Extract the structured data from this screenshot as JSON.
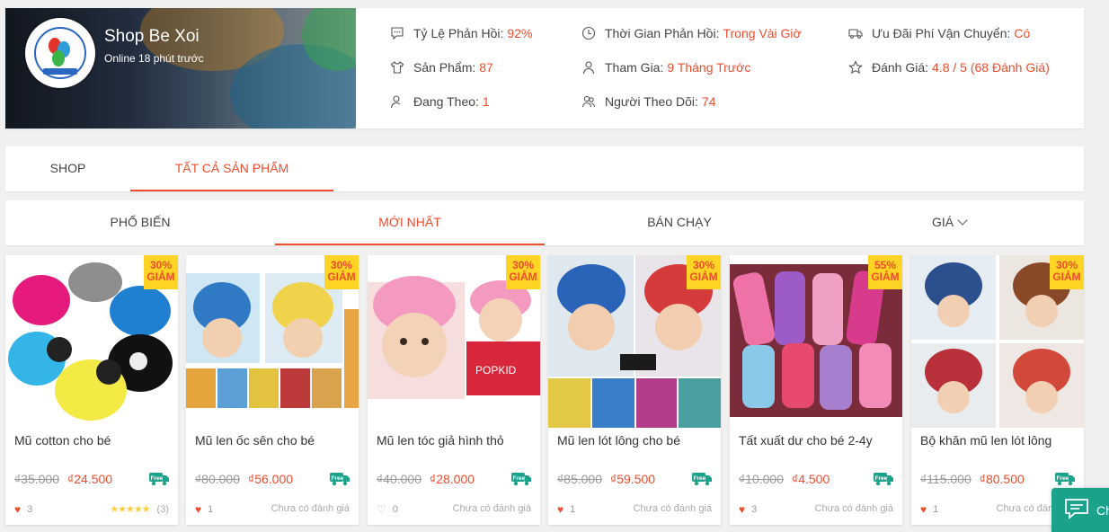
{
  "shop": {
    "name": "Shop Be Xoi",
    "online": "Online 18 phút trước"
  },
  "stats": [
    {
      "icon": "chat-bubble-icon",
      "label": "Tỷ Lệ Phản Hồi:",
      "value": "92%"
    },
    {
      "icon": "clock-icon",
      "label": "Thời Gian Phản Hồi:",
      "value": "Trong Vài Giờ"
    },
    {
      "icon": "truck-icon",
      "label": "Ưu Đãi Phí Vận Chuyển:",
      "value": "Có"
    },
    {
      "icon": "shirt-icon",
      "label": "Sản Phẩm:",
      "value": "87"
    },
    {
      "icon": "user-icon",
      "label": "Tham Gia:",
      "value": "9 Tháng Trước"
    },
    {
      "icon": "star-icon",
      "label": "Đánh Giá:",
      "value": "4.8 / 5 (68 Đánh Giá)"
    },
    {
      "icon": "user-follow-icon",
      "label": "Đang Theo:",
      "value": "1"
    },
    {
      "icon": "users-icon",
      "label": "Người Theo Dõi:",
      "value": "74"
    }
  ],
  "tabs": [
    {
      "label": "SHOP"
    },
    {
      "label": "TẤT CẢ SẢN PHẨM"
    }
  ],
  "sort": [
    {
      "label": "PHỔ BIẾN"
    },
    {
      "label": "MỚI NHẤT"
    },
    {
      "label": "BÁN CHẠY"
    },
    {
      "label": "GIÁ"
    }
  ],
  "discount_word": "GIẢM",
  "products": [
    {
      "title": "Mũ cotton cho bé",
      "old_price": "₫35.000",
      "price": "₫24.500",
      "discount": "30%",
      "likes": "3",
      "liked": true,
      "rating_text": "(3)",
      "rating": 4.5
    },
    {
      "title": "Mũ len ốc sên cho bé",
      "old_price": "₫80.000",
      "price": "₫56.000",
      "discount": "30%",
      "likes": "1",
      "liked": true,
      "rating_text": "Chưa có đánh giá"
    },
    {
      "title": "Mũ len tóc giả hình thỏ",
      "old_price": "₫40.000",
      "price": "₫28.000",
      "discount": "30%",
      "likes": "0",
      "liked": false,
      "rating_text": "Chưa có đánh giá"
    },
    {
      "title": "Mũ len lót lông cho bé",
      "old_price": "₫85.000",
      "price": "₫59.500",
      "discount": "30%",
      "likes": "1",
      "liked": true,
      "rating_text": "Chưa có đánh giá"
    },
    {
      "title": "Tất xuất dư cho bé 2-4y",
      "old_price": "₫10.000",
      "price": "₫4.500",
      "discount": "55%",
      "likes": "3",
      "liked": true,
      "rating_text": "Chưa có đánh giá"
    },
    {
      "title": "Bộ khăn mũ len lót lông",
      "old_price": "₫115.000",
      "price": "₫80.500",
      "discount": "30%",
      "likes": "1",
      "liked": true,
      "rating_text": "Chưa có đánh giá"
    }
  ],
  "free_ship_label": "Free",
  "chat": {
    "label": "Ch"
  },
  "colors": {
    "accent": "#ee4d2d",
    "badge": "#ffd424",
    "chat": "#1aa38a"
  }
}
